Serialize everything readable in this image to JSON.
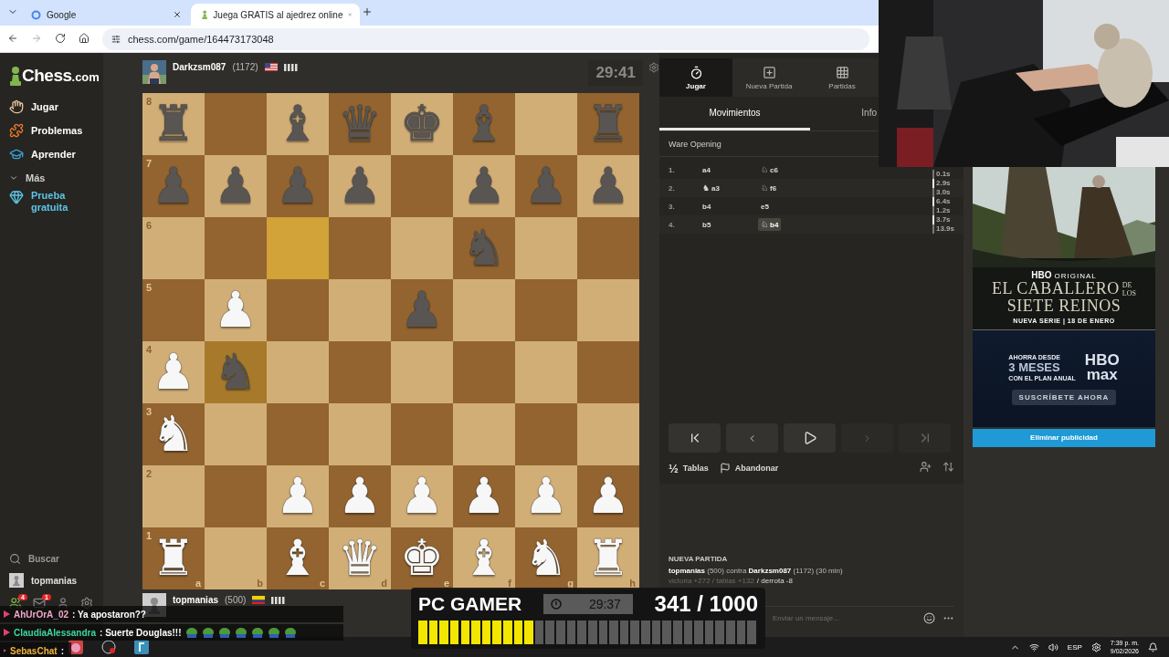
{
  "browser": {
    "tabs": [
      {
        "title": "Google",
        "selected": false
      },
      {
        "title": "Juega GRATIS al ajedrez online",
        "selected": true
      }
    ],
    "url": "chess.com/game/164473173048"
  },
  "sidebar": {
    "logo": {
      "name": "Chess",
      "suffix": ".com"
    },
    "items": [
      {
        "label": "Jugar",
        "kind": "play"
      },
      {
        "label": "Problemas",
        "kind": "puzzles"
      },
      {
        "label": "Aprender",
        "kind": "learn"
      },
      {
        "label": "Más",
        "kind": "more"
      },
      {
        "label": "Prueba gratuita",
        "kind": "trial"
      }
    ],
    "search": "Buscar",
    "user": "topmanias",
    "badges": [
      "4",
      "1"
    ]
  },
  "opponent": {
    "name": "Darkzsm087",
    "rating": "(1172)",
    "clock": "29:41"
  },
  "player": {
    "name": "topmanias",
    "rating": "(500)"
  },
  "board": {
    "files": [
      "a",
      "b",
      "c",
      "d",
      "e",
      "f",
      "g",
      "h"
    ],
    "ranks": [
      {
        "label": "8",
        "squares": [
          {
            "piece": "♜",
            "white": false,
            "highlighted": false
          },
          {
            "highlighted": false
          },
          {
            "piece": "♝",
            "white": false,
            "highlighted": false
          },
          {
            "piece": "♛",
            "white": false,
            "highlighted": false
          },
          {
            "piece": "♚",
            "white": false,
            "highlighted": false
          },
          {
            "piece": "♝",
            "white": false,
            "highlighted": false
          },
          {
            "highlighted": false
          },
          {
            "piece": "♜",
            "white": false,
            "highlighted": false
          }
        ]
      },
      {
        "label": "7",
        "squares": [
          {
            "piece": "♟",
            "white": false,
            "highlighted": false
          },
          {
            "piece": "♟",
            "white": false,
            "highlighted": false
          },
          {
            "piece": "♟",
            "white": false,
            "highlighted": false
          },
          {
            "piece": "♟",
            "white": false,
            "highlighted": false
          },
          {
            "highlighted": false
          },
          {
            "piece": "♟",
            "white": false,
            "highlighted": false
          },
          {
            "piece": "♟",
            "white": false,
            "highlighted": false
          },
          {
            "piece": "♟",
            "white": false,
            "highlighted": false
          }
        ]
      },
      {
        "label": "6",
        "squares": [
          {
            "highlighted": false
          },
          {
            "highlighted": false
          },
          {
            "highlighted": true
          },
          {
            "highlighted": false
          },
          {
            "highlighted": false
          },
          {
            "piece": "♞",
            "white": false,
            "highlighted": false
          },
          {
            "highlighted": false
          },
          {
            "highlighted": false
          }
        ]
      },
      {
        "label": "5",
        "squares": [
          {
            "highlighted": false
          },
          {
            "piece": "♟",
            "white": true,
            "highlighted": false
          },
          {
            "highlighted": false
          },
          {
            "highlighted": false
          },
          {
            "piece": "♟",
            "white": false,
            "highlighted": false
          },
          {
            "highlighted": false
          },
          {
            "highlighted": false
          },
          {
            "highlighted": false
          }
        ]
      },
      {
        "label": "4",
        "squares": [
          {
            "piece": "♟",
            "white": true,
            "highlighted": false
          },
          {
            "piece": "♞",
            "white": false,
            "highlighted": true
          },
          {
            "highlighted": false
          },
          {
            "highlighted": false
          },
          {
            "highlighted": false
          },
          {
            "highlighted": false
          },
          {
            "highlighted": false
          },
          {
            "highlighted": false
          }
        ]
      },
      {
        "label": "3",
        "squares": [
          {
            "piece": "♞",
            "white": true,
            "highlighted": false
          },
          {
            "highlighted": false
          },
          {
            "highlighted": false
          },
          {
            "highlighted": false
          },
          {
            "highlighted": false
          },
          {
            "highlighted": false
          },
          {
            "highlighted": false
          },
          {
            "highlighted": false
          }
        ]
      },
      {
        "label": "2",
        "squares": [
          {
            "highlighted": false
          },
          {
            "highlighted": false
          },
          {
            "piece": "♟",
            "white": true,
            "highlighted": false
          },
          {
            "piece": "♟",
            "white": true,
            "highlighted": false
          },
          {
            "piece": "♟",
            "white": true,
            "highlighted": false
          },
          {
            "piece": "♟",
            "white": true,
            "highlighted": false
          },
          {
            "piece": "♟",
            "white": true,
            "highlighted": false
          },
          {
            "piece": "♟",
            "white": true,
            "highlighted": false
          }
        ]
      },
      {
        "label": "1",
        "squares": [
          {
            "piece": "♜",
            "white": true,
            "highlighted": false
          },
          {
            "highlighted": false
          },
          {
            "piece": "♝",
            "white": true,
            "highlighted": false
          },
          {
            "piece": "♛",
            "white": true,
            "highlighted": false
          },
          {
            "piece": "♚",
            "white": true,
            "highlighted": false
          },
          {
            "piece": "♝",
            "white": true,
            "highlighted": false
          },
          {
            "piece": "♞",
            "white": true,
            "highlighted": false
          },
          {
            "piece": "♜",
            "white": true,
            "highlighted": false
          }
        ]
      }
    ]
  },
  "panel": {
    "tabs": [
      {
        "label": "Jugar",
        "kind": "play",
        "selected": true
      },
      {
        "label": "Nueva Partida",
        "kind": "new",
        "selected": false
      },
      {
        "label": "Partidas",
        "kind": "games",
        "selected": false
      }
    ],
    "subtabs": [
      {
        "label": "Movimientos",
        "selected": true
      },
      {
        "label": "Info",
        "selected": false
      }
    ],
    "opening": "Ware Opening",
    "moves": [
      {
        "number": "1.",
        "white": {
          "san": "a4",
          "selected": false
        },
        "black": {
          "figure": "♘",
          "san": "c6",
          "selected": false
        },
        "times": [
          {
            "text": "0.1s",
            "white": false
          }
        ]
      },
      {
        "number": "2.",
        "white": {
          "figure": "♞",
          "san": "a3",
          "selected": false
        },
        "black": {
          "figure": "♘",
          "san": "f6",
          "selected": false
        },
        "times": [
          {
            "text": "2.9s",
            "white": true
          },
          {
            "text": "3.0s",
            "white": false
          }
        ]
      },
      {
        "number": "3.",
        "white": {
          "san": "b4",
          "selected": false
        },
        "black": {
          "san": "e5",
          "selected": false
        },
        "times": [
          {
            "text": "6.4s",
            "white": true
          },
          {
            "text": "1.2s",
            "white": false
          }
        ]
      },
      {
        "number": "4.",
        "white": {
          "san": "b5",
          "selected": false
        },
        "black": {
          "figure": "♘",
          "san": "b4",
          "selected": true
        },
        "times": [
          {
            "text": "3.7s",
            "white": true
          },
          {
            "text": "13.9s",
            "white": false
          }
        ]
      }
    ],
    "nav": [
      {
        "kind": "first",
        "disabled": false
      },
      {
        "kind": "prev",
        "disabled": false
      },
      {
        "kind": "play",
        "disabled": false
      },
      {
        "kind": "next",
        "disabled": true
      },
      {
        "kind": "last",
        "disabled": true
      }
    ],
    "actions": [
      {
        "kind": "draw",
        "symbol": "½",
        "label": "Tablas"
      },
      {
        "kind": "resign",
        "label": "Abandonar"
      }
    ],
    "chat": {
      "title": "NUEVA PARTIDA",
      "match": "**topmanias** (500) contra **Darkzsm087** (1172) (30 min)",
      "result_muted": "victoria +272 / tablas +132",
      "result": "/ derrota -8",
      "placeholder": "Enviar un mensaje..."
    }
  },
  "ad": {
    "brand": "HBO",
    "brand_tag": "ORIGINAL",
    "title": "EL CABALLERO",
    "title_small": [
      "DE",
      "LOS"
    ],
    "title_2": "SIETE REINOS",
    "date": "NUEVA SERIE | 18 DE ENERO",
    "promo": [
      "AHORRA DESDE",
      "3 MESES",
      "CON EL PLAN ANUAL"
    ],
    "logo": [
      "HBO",
      "max"
    ],
    "cta": "SUSCRÍBETE AHORA",
    "remove": "Eliminar publicidad"
  },
  "stream": {
    "title": "PC GAMER",
    "timer": "29:37",
    "score": "341 / 1000",
    "level": 0.341
  },
  "chat_overlay": [
    {
      "user": "AhUrOrA_02",
      "color": "#f2a7c6",
      "text": ": Ya apostaron??"
    },
    {
      "user": "ClaudiaAlessandra",
      "color": "#3fd6a0",
      "text": ": Suerte Douglas!!!"
    },
    {
      "user": "SebasChat",
      "color": "#f2b340",
      "text": ":"
    }
  ],
  "taskbar": {
    "language": "ESP",
    "time": "7:39 p. m.",
    "date": "9/02/2026"
  }
}
